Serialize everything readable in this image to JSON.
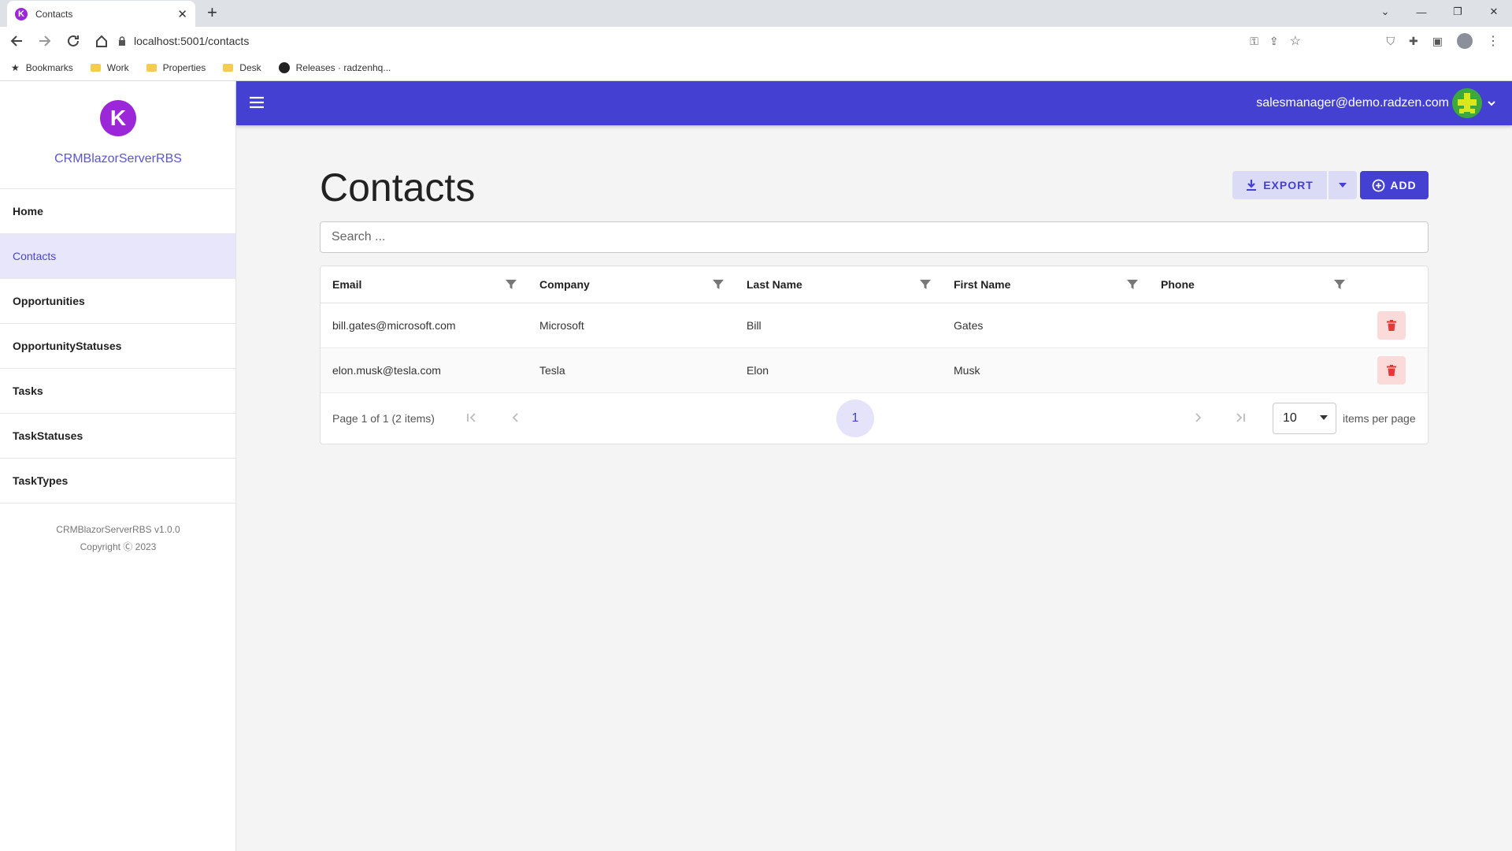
{
  "browser": {
    "tab_title": "Contacts",
    "tab_favicon_letter": "K",
    "url": "localhost:5001/contacts",
    "bookmarks": [
      "Bookmarks",
      "Work",
      "Properties",
      "Desk",
      "Releases · radzenhq..."
    ]
  },
  "sidebar": {
    "logo_letter": "K",
    "app_name": "CRMBlazorServerRBS",
    "items": [
      {
        "label": "Home"
      },
      {
        "label": "Contacts"
      },
      {
        "label": "Opportunities"
      },
      {
        "label": "OpportunityStatuses"
      },
      {
        "label": "Tasks"
      },
      {
        "label": "TaskStatuses"
      },
      {
        "label": "TaskTypes"
      }
    ],
    "active_item": "Contacts",
    "version": "CRMBlazorServerRBS v1.0.0",
    "copyright": "Copyright Ⓒ 2023"
  },
  "header": {
    "user_email": "salesmanager@demo.radzen.com"
  },
  "main": {
    "title": "Contacts",
    "export_label": "EXPORT",
    "add_label": "ADD",
    "search_placeholder": "Search ..."
  },
  "grid": {
    "columns": [
      "Email",
      "Company",
      "Last Name",
      "First Name",
      "Phone"
    ],
    "rows": [
      {
        "email": "bill.gates@microsoft.com",
        "company": "Microsoft",
        "last_name": "Bill",
        "first_name": "Gates",
        "phone": ""
      },
      {
        "email": "elon.musk@tesla.com",
        "company": "Tesla",
        "last_name": "Elon",
        "first_name": "Musk",
        "phone": ""
      }
    ],
    "pager_info": "Page 1 of 1 (2 items)",
    "current_page": "1",
    "page_size": "10",
    "items_per_page_label": "items per page"
  },
  "colors": {
    "primary": "#4340d2",
    "danger": "#e53935",
    "logo": "#9b27d8"
  }
}
